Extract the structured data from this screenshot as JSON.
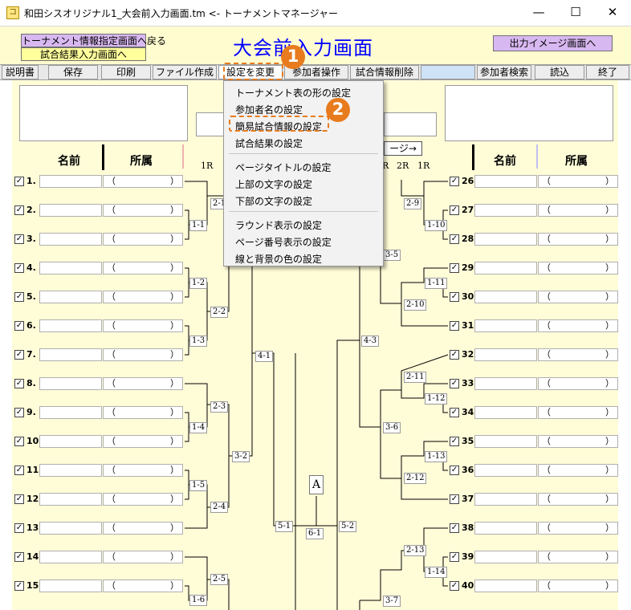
{
  "window": {
    "title": "和田シスオリジナル1_大会前入力画面.tm <- トーナメントマネージャー",
    "app_icon": "コ",
    "minimize": "—",
    "maximize": "☐",
    "close": "✕"
  },
  "header": {
    "back_button": "トーナメント情報指定画面へ戻る",
    "result_button": "試合結果入力画面へ",
    "title": "大会前入力画面",
    "output_button": "出力イメージ画面へ"
  },
  "toolbar": {
    "help": "説明書",
    "save": "保存",
    "print": "印刷",
    "file": "ファイル作成",
    "settings": "設定を変更",
    "participant_ops": "参加者操作",
    "delete_match": "試合情報削除",
    "search": "参加者検索",
    "load": "読込",
    "exit": "終了"
  },
  "menu": {
    "items": [
      "トーナメント表の形の設定",
      "参加者名の設定",
      "簡易試合情報の設定",
      "試合結果の設定",
      "ページタイトルの設定",
      "上部の文字の設定",
      "下部の文字の設定",
      "ラウンド表示の設定",
      "ページ番号表示の設定",
      "線と背景の色の設定"
    ]
  },
  "callouts": {
    "one": "1",
    "two": "2"
  },
  "columns": {
    "name": "名前",
    "affiliation": "所属",
    "paren_open": "（",
    "paren_close": "）",
    "check": "✓"
  },
  "round_labels_left": [
    "1R"
  ],
  "round_labels_right": [
    "R",
    "2R",
    "1R"
  ],
  "page_button": "ージ→",
  "left_participants": [
    "1.",
    "2.",
    "3.",
    "4.",
    "5.",
    "6.",
    "7.",
    "8.",
    "9.",
    "10.",
    "11.",
    "12.",
    "13.",
    "14.",
    "15."
  ],
  "right_participants": [
    "26.",
    "27.",
    "28.",
    "29.",
    "30.",
    "31.",
    "32.",
    "33.",
    "34.",
    "35.",
    "36.",
    "37.",
    "38.",
    "39.",
    "40."
  ],
  "matches": {
    "m2_1": "2-1",
    "m1_1": "1-1",
    "m1_2": "1-2",
    "m2_2": "2-2",
    "m1_3": "1-3",
    "m4_1": "4-1",
    "m2_3": "2-3",
    "m1_4": "1-4",
    "m3_2": "3-2",
    "m1_5": "1-5",
    "m2_4": "2-4",
    "m5_1": "5-1",
    "m6_1": "6-1",
    "final_mark": "A",
    "m2_5": "2-5",
    "m1_6": "1-6",
    "m2_9": "2-9",
    "m1_10": "1-10",
    "m3_5": "3-5",
    "m1_11": "1-11",
    "m2_10": "2-10",
    "m4_3": "4-3",
    "m2_11": "2-11",
    "m1_12": "1-12",
    "m3_6": "3-6",
    "m1_13": "1-13",
    "m2_12": "2-12",
    "m5_2": "5-2",
    "m2_13": "2-13",
    "m1_14": "1-14",
    "m3_7": "3-7"
  },
  "colors": {
    "accent_orange": "#e87b1e",
    "title_blue": "#0000ff",
    "background": "#fffcd8"
  }
}
